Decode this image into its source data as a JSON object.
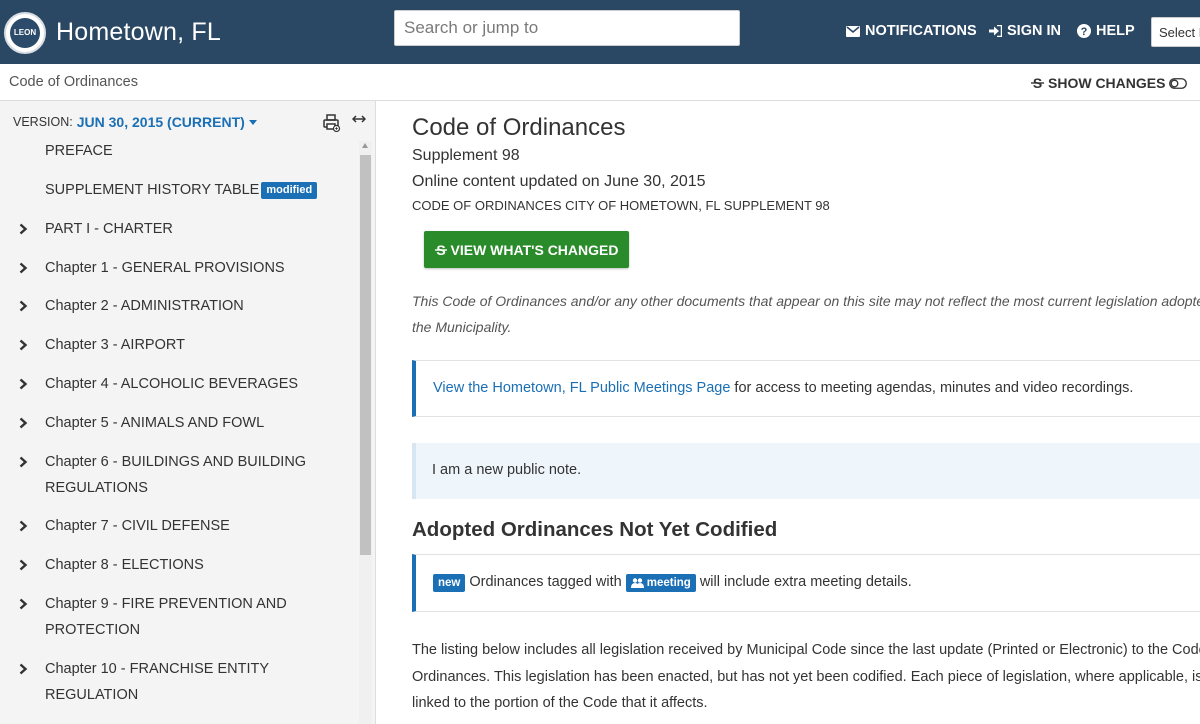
{
  "header": {
    "logo_text": "LEON",
    "site_title": "Hometown, FL",
    "search_placeholder": "Search or jump to",
    "nav": {
      "notifications": "NOTIFICATIONS",
      "sign_in": "SIGN IN",
      "help": "HELP"
    },
    "translate_label": "Select Language"
  },
  "breadcrumb": "Code of Ordinances",
  "show_changes": "SHOW CHANGES",
  "sidebar": {
    "version_label": "VERSION:",
    "version_value": "JUN 30, 2015 (CURRENT)",
    "toc": [
      {
        "label": "PREFACE"
      },
      {
        "label": "SUPPLEMENT HISTORY TABLE",
        "badge": "modified"
      },
      {
        "label": "PART I - CHARTER"
      },
      {
        "label": "Chapter 1 - GENERAL PROVISIONS"
      },
      {
        "label": "Chapter 2 - ADMINISTRATION"
      },
      {
        "label": "Chapter 3 - AIRPORT"
      },
      {
        "label": "Chapter 4 - ALCOHOLIC BEVERAGES"
      },
      {
        "label": "Chapter 5 - ANIMALS AND FOWL"
      },
      {
        "label": "Chapter 6 - BUILDINGS AND BUILDING REGULATIONS"
      },
      {
        "label": "Chapter 7 - CIVIL DEFENSE"
      },
      {
        "label": "Chapter 8 - ELECTIONS"
      },
      {
        "label": "Chapter 9 - FIRE PREVENTION AND PROTECTION"
      },
      {
        "label": "Chapter 10 - FRANCHISE ENTITY REGULATION"
      }
    ]
  },
  "main": {
    "title": "Code of Ordinances",
    "supplement": "Supplement 98",
    "updated": "Online content updated on June 30, 2015",
    "code_line": "CODE OF ORDINANCES CITY OF HOMETOWN, FL SUPPLEMENT 98",
    "view_changes_button": "VIEW WHAT'S CHANGED",
    "disclaimer": "This Code of Ordinances and/or any other documents that appear on this site may not reflect the most current legislation adopted by the Municipality.",
    "meetings_link": "View the Hometown, FL Public Meetings Page",
    "meetings_text": " for access to meeting agendas, minutes and video recordings.",
    "public_note": "I am a new public note.",
    "section_heading": "Adopted Ordinances Not Yet Codified",
    "new_badge": "new",
    "tagged_text_1": "Ordinances tagged with",
    "meeting_tag": "meeting",
    "tagged_text_2": "will include extra meeting details.",
    "listing": "The listing below includes all legislation received by Municipal Code since the last update (Printed or Electronic) to the Code of Ordinances. This legislation has been enacted, but has not yet been codified. Each piece of legislation, where applicable, is linked to the portion of the Code that it affects."
  },
  "colors": {
    "header_bg": "#2a4763",
    "link_blue": "#1a6fb5",
    "button_green": "#2a8b2a",
    "sidebar_bg": "#f4f4f4",
    "note_bg": "#eef5fb"
  }
}
